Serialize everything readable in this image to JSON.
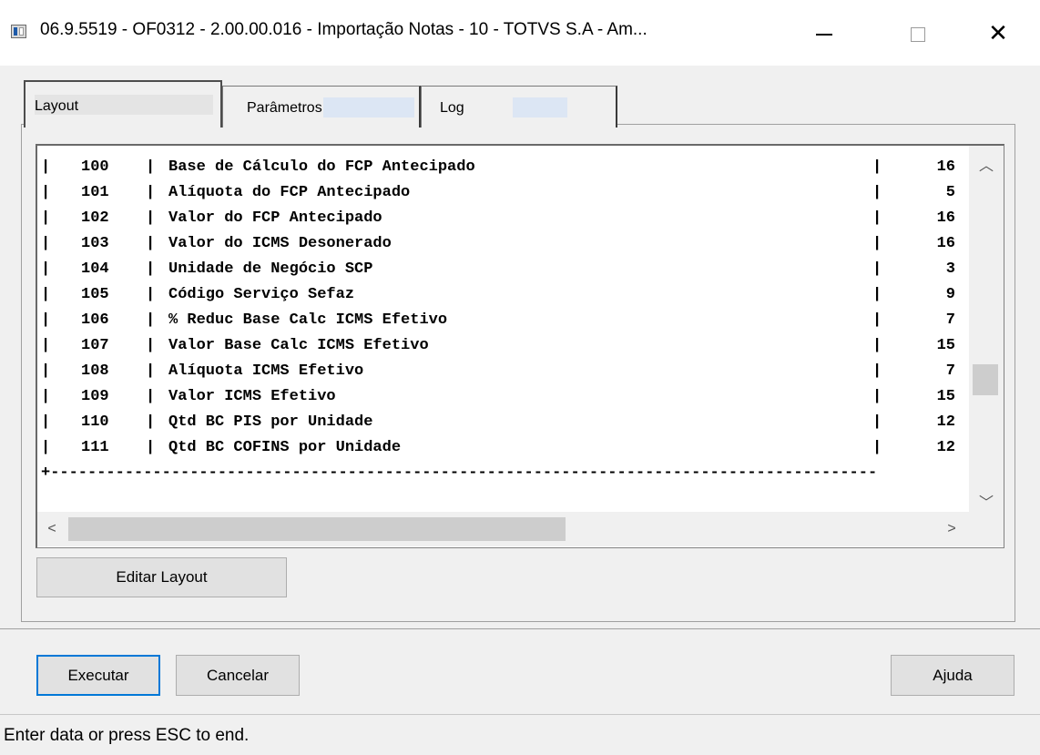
{
  "window": {
    "title": "06.9.5519 - OF0312 - 2.00.00.016 - Importação Notas - 10 - TOTVS S.A - Am...",
    "close_glyph": "✕"
  },
  "tabs": [
    {
      "label": "Layout",
      "active": true
    },
    {
      "label": "Parâmetros",
      "active": false
    },
    {
      "label": "Log",
      "active": false
    }
  ],
  "layout_rows": [
    {
      "num": "100",
      "desc": "Base de Cálculo do FCP Antecipado",
      "len": "16"
    },
    {
      "num": "101",
      "desc": "Alíquota do FCP Antecipado",
      "len": "5"
    },
    {
      "num": "102",
      "desc": "Valor do FCP Antecipado",
      "len": "16"
    },
    {
      "num": "103",
      "desc": "Valor do ICMS Desonerado",
      "len": "16"
    },
    {
      "num": "104",
      "desc": "Unidade de Negócio SCP",
      "len": "3"
    },
    {
      "num": "105",
      "desc": "Código Serviço Sefaz",
      "len": "9"
    },
    {
      "num": "106",
      "desc": "% Reduc Base Calc ICMS Efetivo",
      "len": "7"
    },
    {
      "num": "107",
      "desc": "Valor Base Calc ICMS Efetivo",
      "len": "15"
    },
    {
      "num": "108",
      "desc": "Alíquota ICMS Efetivo",
      "len": "7"
    },
    {
      "num": "109",
      "desc": "Valor ICMS Efetivo",
      "len": "15"
    },
    {
      "num": "110",
      "desc": "Qtd BC PIS por Unidade",
      "len": "12"
    },
    {
      "num": "111",
      "desc": "Qtd BC COFINS por Unidade",
      "len": "12"
    }
  ],
  "separator_line": "+-----------------------------------------------------------------------------------------",
  "pipe": "|",
  "scroll_glyphs": {
    "up": "︿",
    "down": "﹀",
    "left": "<",
    "right": ">"
  },
  "buttons": {
    "edit_layout": "Editar Layout",
    "execute": "Executar",
    "cancel": "Cancelar",
    "help": "Ajuda"
  },
  "status_text": "Enter data or press ESC to end."
}
